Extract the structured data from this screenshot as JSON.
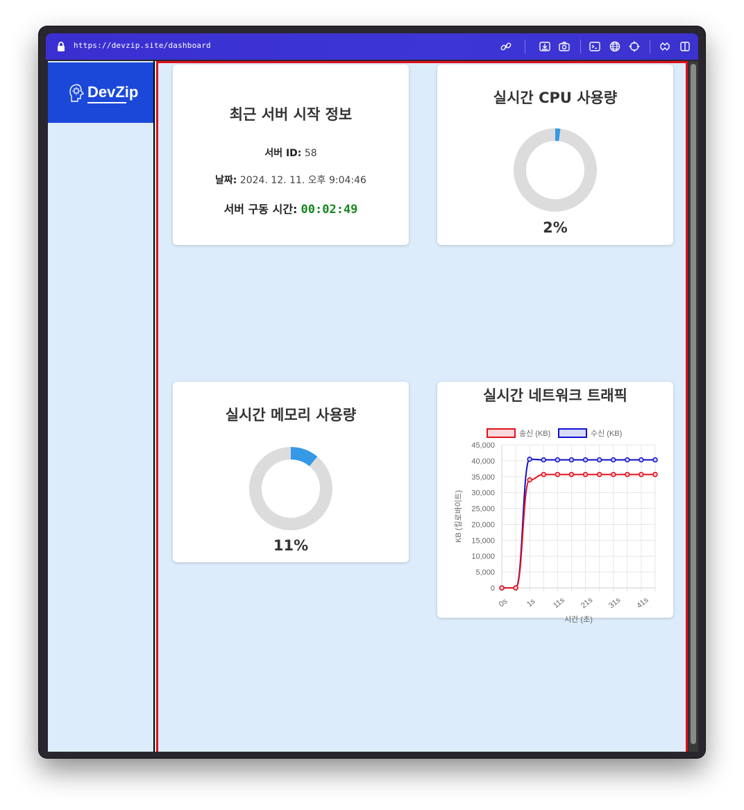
{
  "browser": {
    "url": "https://devzip.site/dashboard",
    "accent": "#3b32d0"
  },
  "sidebar": {
    "logo_text": "DevZip",
    "logo_color": "#1b48d8"
  },
  "server_card": {
    "title": "최근 서버 시작 정보",
    "server_id_label": "서버 ID:",
    "server_id_value": "58",
    "date_label": "날짜:",
    "date_value": "2024. 12. 11. 오후 9:04:46",
    "uptime_label": "서버 구동 시간:",
    "uptime_value": "00:02:49"
  },
  "cpu_card": {
    "title": "실시간 CPU 사용량",
    "percent_label": "2%",
    "percent": 2
  },
  "memory_card": {
    "title": "실시간 메모리 사용량",
    "percent_label": "11%",
    "percent": 11
  },
  "network_card": {
    "title": "실시간 네트워크 트래픽"
  },
  "chart_data": {
    "type": "line",
    "title": "실시간 네트워크 트래픽",
    "xlabel": "시간 (초)",
    "ylabel": "KB (킬로바이트)",
    "x_tick_labels": [
      "0s",
      "1s",
      "11s",
      "21s",
      "31s",
      "41s"
    ],
    "ylim": [
      0,
      45000
    ],
    "y_ticks": [
      "0",
      "5,000",
      "10,000",
      "15,000",
      "20,000",
      "25,000",
      "30,000",
      "35,000",
      "40,000",
      "45,000"
    ],
    "y_tick_values": [
      0,
      5000,
      10000,
      15000,
      20000,
      25000,
      30000,
      35000,
      40000,
      45000
    ],
    "grid": true,
    "legend_position": "top",
    "series": [
      {
        "name": "송신 (KB)",
        "color": "#e0101c",
        "values": [
          0,
          0,
          34000,
          35700,
          35700,
          35700,
          35700,
          35700,
          35700,
          35700,
          35700,
          35700
        ]
      },
      {
        "name": "수신 (KB)",
        "color": "#1010d0",
        "values": [
          0,
          0,
          40500,
          40300,
          40300,
          40300,
          40300,
          40300,
          40300,
          40300,
          40300,
          40300
        ]
      }
    ]
  }
}
